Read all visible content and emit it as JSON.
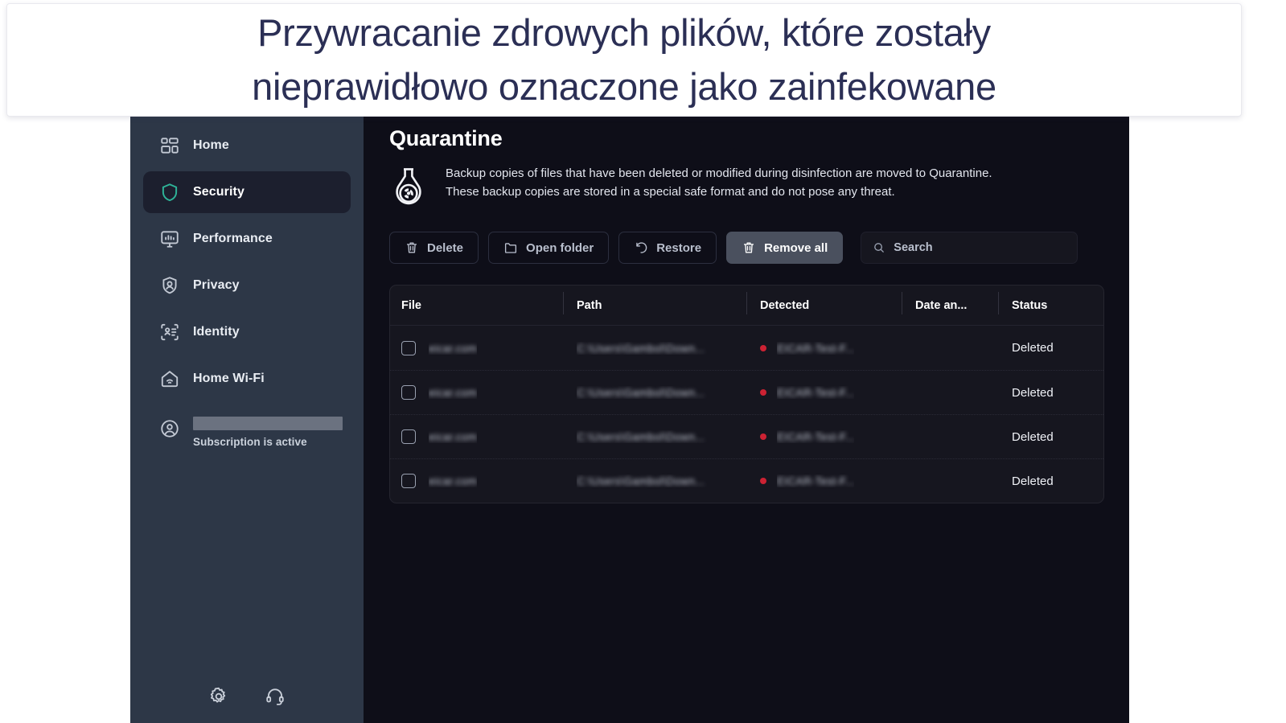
{
  "banner": {
    "text": "Przywracanie zdrowych plików, które zostały\nnieprawidłowo oznaczone jako zainfekowane"
  },
  "colors": {
    "sidebar_bg": "#2d3747",
    "main_bg": "#0e0e18",
    "panel_bg": "#16161f",
    "accent_teal": "#2eb398",
    "active_item_bg": "#1c1f2e",
    "primary_button_bg": "#4a505e",
    "threat_dot": "#cc2233",
    "banner_text": "#2b2f55"
  },
  "sidebar": {
    "items": [
      {
        "label": "Home",
        "icon": "dashboard-icon",
        "active": false
      },
      {
        "label": "Security",
        "icon": "shield-icon",
        "active": true
      },
      {
        "label": "Performance",
        "icon": "monitor-icon",
        "active": false
      },
      {
        "label": "Privacy",
        "icon": "privacy-user-icon",
        "active": false
      },
      {
        "label": "Identity",
        "icon": "id-card-icon",
        "active": false
      },
      {
        "label": "Home Wi-Fi",
        "icon": "home-wifi-icon",
        "active": false
      }
    ],
    "account": {
      "icon": "account-avatar-icon",
      "name_redacted": true,
      "status": "Subscription is active"
    },
    "footer_icons": [
      {
        "name": "gear-icon"
      },
      {
        "name": "headset-support-icon"
      }
    ]
  },
  "main": {
    "title": "Quarantine",
    "intro_icon": "flask-radiation-icon",
    "intro_line1": "Backup copies of files that have been deleted or modified during disinfection are moved to Quarantine.",
    "intro_line2": "These backup copies are stored in a special safe format and do not pose any threat.",
    "toolbar": {
      "delete_label": "Delete",
      "open_folder_label": "Open folder",
      "restore_label": "Restore",
      "remove_all_label": "Remove all",
      "search_placeholder": "Search",
      "search_value": ""
    },
    "table": {
      "headers": [
        "File",
        "Path",
        "Detected",
        "Date an...",
        "Status"
      ],
      "rows": [
        {
          "file": "eicar.com",
          "path": "C:\\Users\\Gambol\\Down...",
          "detected": "EICAR-Test-F...",
          "date": "",
          "status": "Deleted"
        },
        {
          "file": "eicar.com",
          "path": "C:\\Users\\Gambol\\Down...",
          "detected": "EICAR-Test-F...",
          "date": "",
          "status": "Deleted"
        },
        {
          "file": "eicar.com",
          "path": "C:\\Users\\Gambol\\Down...",
          "detected": "EICAR-Test-F...",
          "date": "",
          "status": "Deleted"
        },
        {
          "file": "eicar.com",
          "path": "C:\\Users\\Gambol\\Down...",
          "detected": "EICAR-Test-F...",
          "date": "",
          "status": "Deleted"
        }
      ]
    }
  }
}
